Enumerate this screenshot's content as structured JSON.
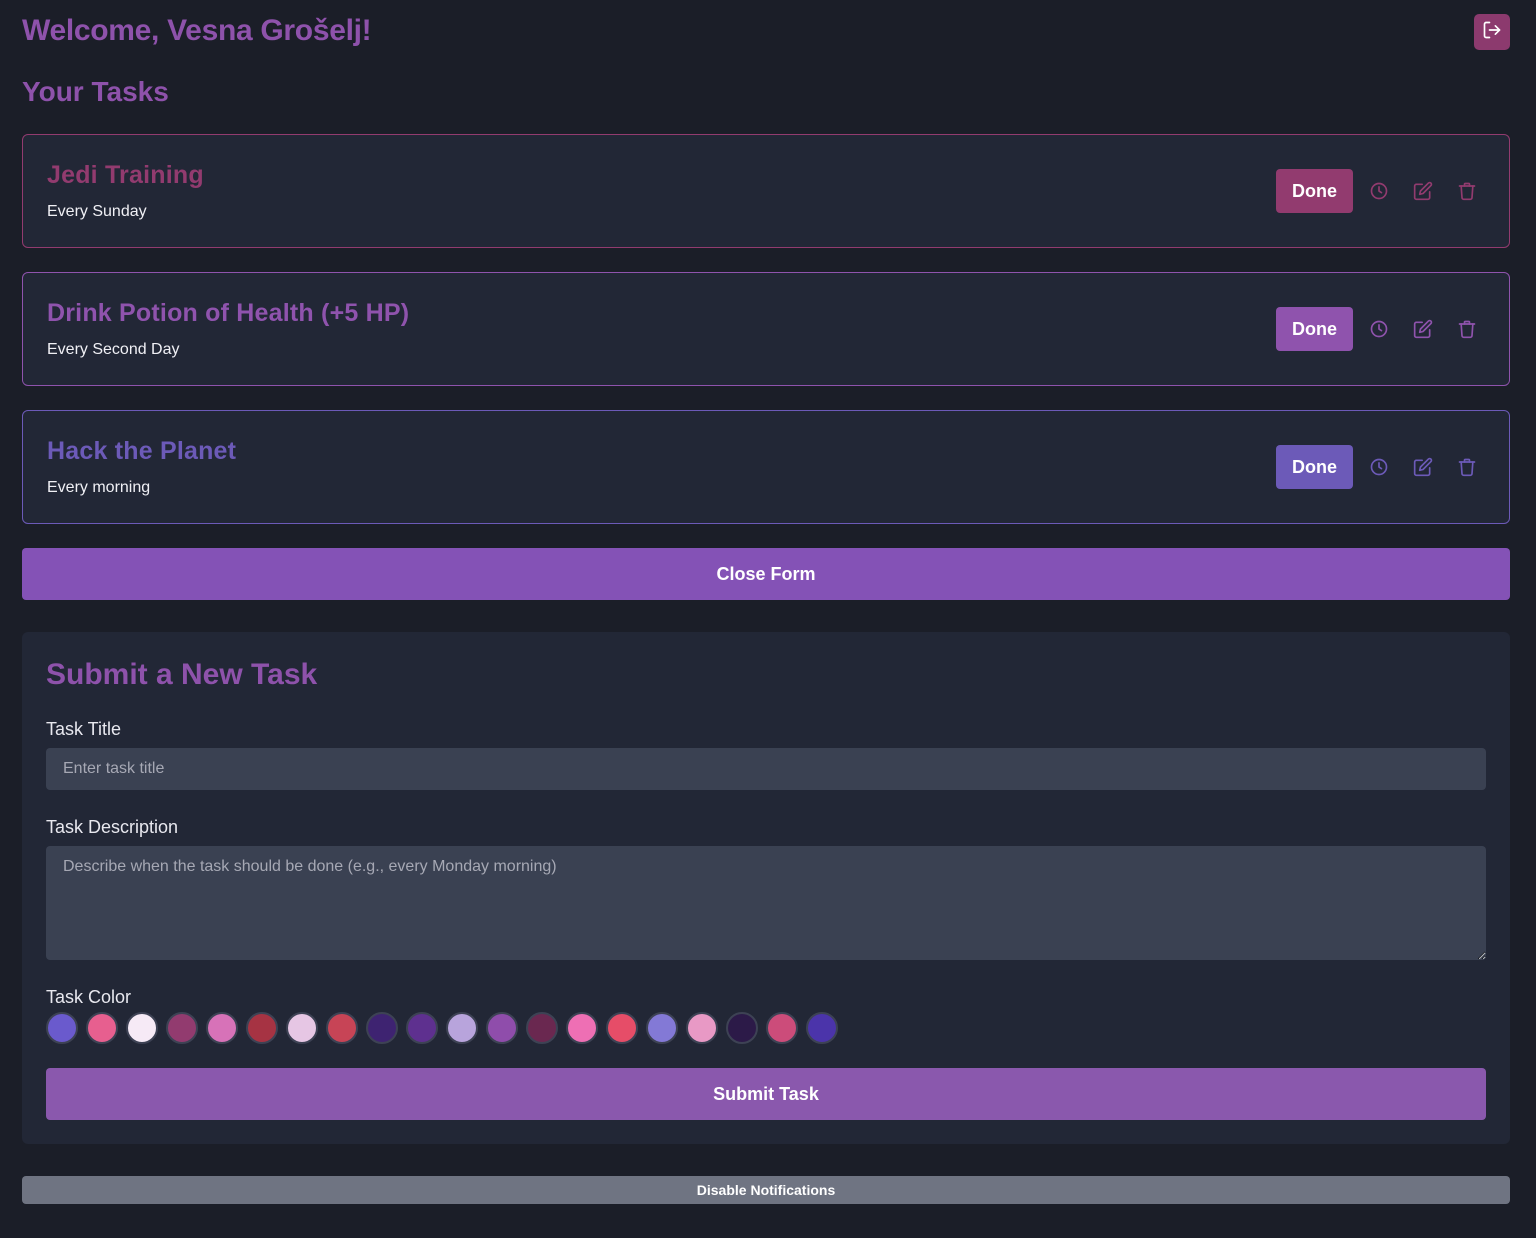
{
  "header": {
    "welcome": "Welcome, Vesna Grošelj!",
    "logout_icon": "logout-icon"
  },
  "tasks_section": {
    "title": "Your Tasks",
    "tasks": [
      {
        "title": "Jedi Training",
        "description": "Every Sunday",
        "done_label": "Done",
        "color": "#923b6f"
      },
      {
        "title": "Drink Potion of Health (+5 HP)",
        "description": "Every Second Day",
        "done_label": "Done",
        "color": "#8f53ad"
      },
      {
        "title": "Hack the Planet",
        "description": "Every morning",
        "done_label": "Done",
        "color": "#6c5ab8"
      }
    ],
    "task_icons": [
      "clock-icon",
      "edit-icon",
      "trash-icon"
    ]
  },
  "close_form_label": "Close Form",
  "form": {
    "title": "Submit a New Task",
    "title_label": "Task Title",
    "title_placeholder": "Enter task title",
    "description_label": "Task Description",
    "description_placeholder": "Describe when the task should be done (e.g., every Monday morning)",
    "color_label": "Task Color",
    "colors": [
      "#6a5acd",
      "#e75f8f",
      "#f6eaf6",
      "#923b6f",
      "#d772b8",
      "#a63343",
      "#e6c6e4",
      "#c74456",
      "#3e2371",
      "#5e308f",
      "#b8a4dc",
      "#8f4dab",
      "#6a2850",
      "#ee6fb4",
      "#e64d68",
      "#8379d6",
      "#e899c5",
      "#2c1a48",
      "#cc4c7a",
      "#4b34aa"
    ],
    "submit_label": "Submit Task"
  },
  "notifications_label": "Disable Notifications",
  "colors": {
    "background": "#1b1e28",
    "panel": "#222736",
    "accent": "#8e52ab",
    "logout": "#8c3a6e"
  }
}
